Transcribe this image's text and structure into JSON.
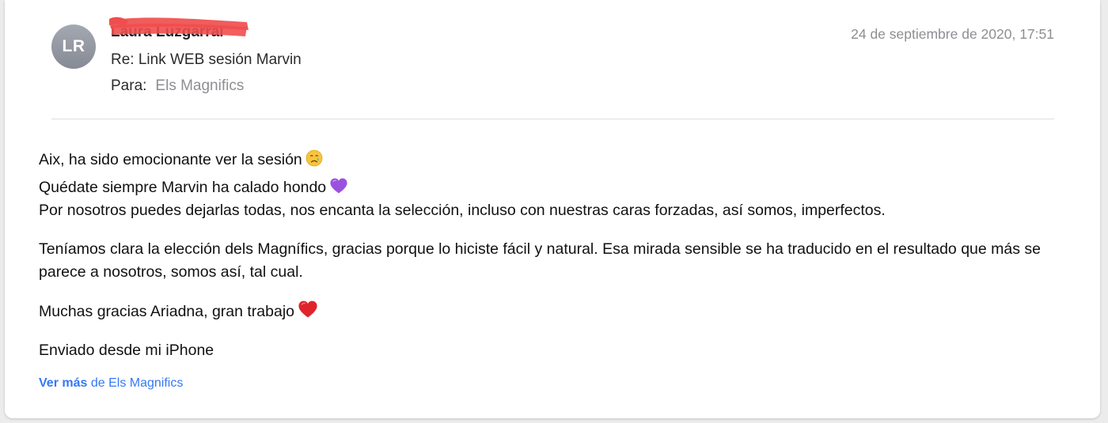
{
  "header": {
    "avatar_initials": "LR",
    "sender_name": "Laura Luzgarral",
    "subject": "Re: Link WEB sesión Marvin",
    "to_label": "Para:",
    "to_recipient": "Els Magnifics",
    "date": "24 de septiembre de 2020, 17:51"
  },
  "body": {
    "line1": "Aix, ha sido emocionante ver la sesión",
    "line1_emoji": "crying-face-icon",
    "line2": "Quédate siempre Marvin ha calado hondo",
    "line2_emoji": "purple-heart-icon",
    "line3": "Por nosotros puedes dejarlas todas, nos encanta la selección, incluso con nuestras caras forzadas, así somos, imperfectos.",
    "paragraph2": "Teníamos clara la elección dels Magnífics, gracias porque lo hiciste fácil y natural. Esa mirada sensible se ha traducido en el resultado que más se parece a nosotros, somos así, tal cual.",
    "thanks": "Muchas gracias Ariadna, gran trabajo",
    "thanks_emoji": "red-heart-icon",
    "signature": "Enviado desde mi iPhone"
  },
  "footer": {
    "see_more": "Ver más",
    "from_text": "de Els Magnifics"
  },
  "colors": {
    "link": "#3478f6",
    "muted": "#8e8e93",
    "redaction": "#f04e4e"
  }
}
